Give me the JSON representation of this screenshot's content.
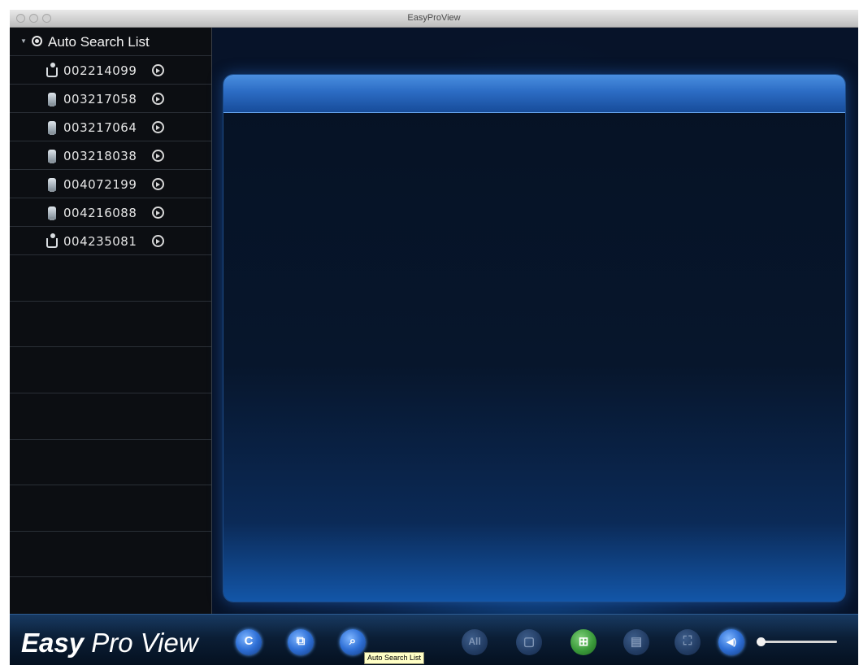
{
  "window": {
    "title": "EasyProView"
  },
  "sidebar": {
    "title": "Auto Search List",
    "devices": [
      {
        "id": "002214099",
        "icon": "dome-camera-icon"
      },
      {
        "id": "003217058",
        "icon": "camera-icon"
      },
      {
        "id": "003217064",
        "icon": "camera-icon"
      },
      {
        "id": "003218038",
        "icon": "camera-icon"
      },
      {
        "id": "004072199",
        "icon": "camera-icon"
      },
      {
        "id": "004216088",
        "icon": "camera-icon"
      },
      {
        "id": "004235081",
        "icon": "dome-camera-icon"
      }
    ]
  },
  "toolbar": {
    "brand_bold": "Easy",
    "brand_light": " Pro View",
    "buttons": [
      {
        "name": "connect-button",
        "glyph": "C"
      },
      {
        "name": "device-list-button",
        "glyph": "⧉"
      },
      {
        "name": "auto-search-button",
        "glyph": "⌕"
      },
      {
        "name": "view-all-button",
        "glyph": "All"
      },
      {
        "name": "single-view-button",
        "glyph": "▢"
      },
      {
        "name": "quad-view-button",
        "glyph": "⊞"
      },
      {
        "name": "layout-button",
        "glyph": "▤"
      },
      {
        "name": "fullscreen-button",
        "glyph": "⛶"
      },
      {
        "name": "volume-button",
        "glyph": "◀)"
      }
    ],
    "tooltip": "Auto Search List",
    "volume": 0.05
  },
  "colors": {
    "accent": "#2f70d6",
    "background": "#0a1a2e",
    "sidebar": "#0c0e12"
  }
}
